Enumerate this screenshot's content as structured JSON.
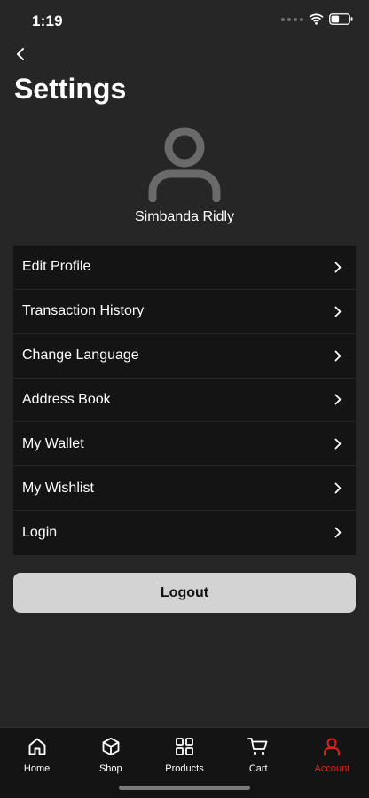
{
  "status_bar": {
    "time": "1:19"
  },
  "header": {
    "title": "Settings"
  },
  "profile": {
    "name": "Simbanda Ridly"
  },
  "menu": {
    "items": [
      {
        "label": "Edit Profile"
      },
      {
        "label": "Transaction History"
      },
      {
        "label": "Change Language"
      },
      {
        "label": "Address Book"
      },
      {
        "label": "My Wallet"
      },
      {
        "label": "My Wishlist"
      },
      {
        "label": "Login"
      }
    ]
  },
  "logout": {
    "label": "Logout"
  },
  "tab_bar": {
    "tabs": [
      {
        "label": "Home",
        "icon": "home-icon"
      },
      {
        "label": "Shop",
        "icon": "box-icon"
      },
      {
        "label": "Products",
        "icon": "grid-icon"
      },
      {
        "label": "Cart",
        "icon": "cart-icon"
      },
      {
        "label": "Account",
        "icon": "user-icon"
      }
    ],
    "active": "Account"
  },
  "colors": {
    "background": "#262626",
    "surface": "#141414",
    "accent": "#e0201d",
    "button": "#d3d3d3"
  }
}
